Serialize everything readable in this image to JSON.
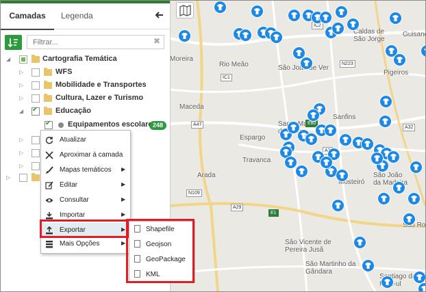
{
  "tabs": [
    "Camadas",
    "Legenda"
  ],
  "filter_placeholder": "Filtrar...",
  "tree": {
    "root": "Cartografia Temática",
    "groups": [
      "WFS",
      "Mobilidade e Transportes",
      "Cultura, Lazer e Turismo",
      "Educação"
    ],
    "layer": "Equipamentos escolares",
    "layer_count": "248"
  },
  "context_menu": {
    "items": [
      "Atualizar",
      "Aproximar à camada",
      "Mapas temáticos",
      "Editar",
      "Consultar",
      "Importar",
      "Exportar",
      "Mais Opções"
    ],
    "highlighted": "Exportar"
  },
  "export_submenu": [
    "Shapefile",
    "Geojson",
    "GeoPackage",
    "KML"
  ],
  "map": {
    "places": [
      "Moreira",
      "Rio Meão",
      "São João de Ver",
      "Caldas de São Jorge",
      "Guisande",
      "Pigeiros",
      "Maceda",
      "Santa Maria da Feira",
      "Sanfins",
      "Espargo",
      "Travanca",
      "Arada",
      "Mosteiró",
      "São João da Madeira",
      "São Vicente de Pereira Jusã",
      "São Martinho da Gândara",
      "Santiago da Riba-ul",
      "São Roq",
      "Guisande"
    ],
    "roads": [
      "IC1",
      "IC2",
      "N223",
      "A47",
      "A29",
      "E1",
      "N109",
      "A1",
      "E80",
      "A32",
      "IC2"
    ]
  },
  "colors": {
    "accent_green": "#2e9a3e",
    "marker_blue": "#1e88e5",
    "highlight_red": "#e31b23"
  }
}
